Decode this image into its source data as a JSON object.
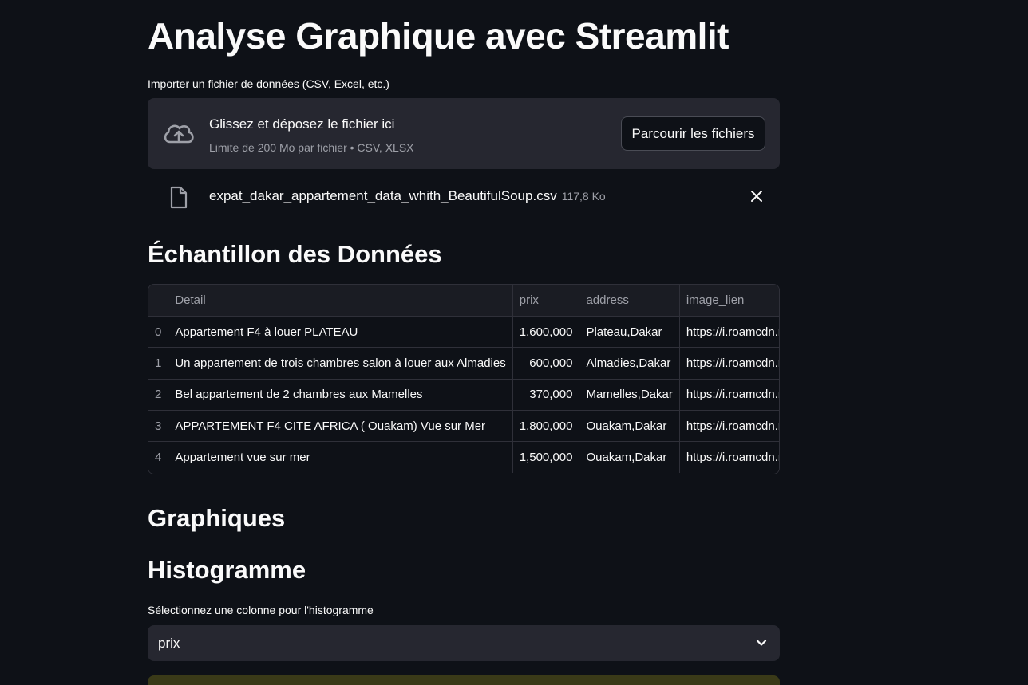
{
  "page": {
    "title": "Analyse Graphique avec Streamlit"
  },
  "uploader": {
    "label": "Importer un fichier de données (CSV, Excel, etc.)",
    "drop_title": "Glissez et déposez le fichier ici",
    "limit_text": "Limite de 200 Mo par fichier • CSV, XLSX",
    "browse_label": "Parcourir les fichiers"
  },
  "file": {
    "name": "expat_dakar_appartement_data_whith_BeautifulSoup.csv",
    "size": "117,8 Ko"
  },
  "sample": {
    "heading": "Échantillon des Données",
    "columns": [
      "",
      "Detail",
      "prix",
      "address",
      "image_lien"
    ],
    "rows": [
      [
        "0",
        "Appartement F4 à louer PLATEAU",
        "1,600,000",
        "Plateau,Dakar",
        "https://i.roamcdn.net"
      ],
      [
        "1",
        "Un appartement de trois chambres salon à louer aux Almadies",
        "600,000",
        "Almadies,Dakar",
        "https://i.roamcdn.net"
      ],
      [
        "2",
        "Bel appartement de 2 chambres aux Mamelles",
        "370,000",
        "Mamelles,Dakar",
        "https://i.roamcdn.net"
      ],
      [
        "3",
        "APPARTEMENT F4 CITE AFRICA ( Ouakam) Vue sur Mer",
        "1,800,000",
        "Ouakam,Dakar",
        "https://i.roamcdn.net"
      ],
      [
        "4",
        "Appartement vue sur mer",
        "1,500,000",
        "Ouakam,Dakar",
        "https://i.roamcdn.net"
      ]
    ]
  },
  "graphs": {
    "heading": "Graphiques"
  },
  "histogram": {
    "heading": "Histogramme",
    "select_label": "Sélectionnez une colonne pour l'histogramme",
    "selected": "prix"
  },
  "colors": {
    "background": "#0e1117",
    "surface": "#262730",
    "muted_text": "#9ea0a8"
  },
  "icons": {
    "upload": "cloud-upload-icon",
    "file": "file-icon",
    "close": "close-icon",
    "dropdown": "chevron-down-icon"
  }
}
